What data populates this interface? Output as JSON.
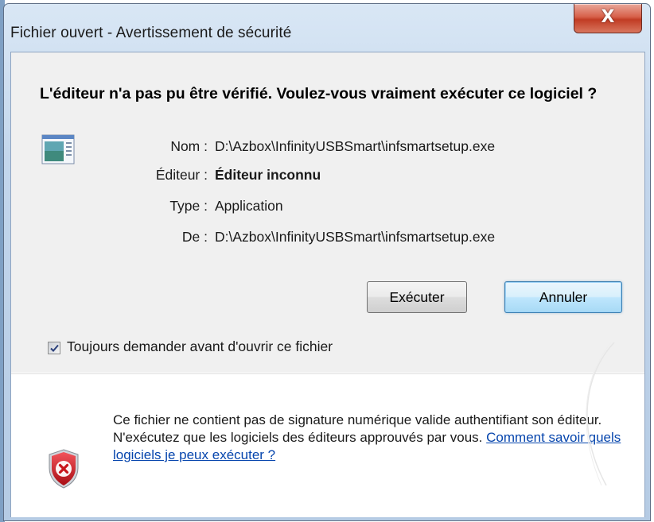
{
  "window": {
    "title": "Fichier ouvert - Avertissement de sécurité",
    "close_glyph": "X"
  },
  "heading": "L'éditeur n'a pas pu être vérifié. Voulez-vous vraiment exécuter ce logiciel ?",
  "details": [
    {
      "label": "Nom :",
      "value": "D:\\Azbox\\InfinityUSBSmart\\infsmartsetup.exe"
    },
    {
      "label": "Éditeur :",
      "value": "Éditeur inconnu"
    },
    {
      "label": "Type :",
      "value": "Application"
    },
    {
      "label": "De :",
      "value": "D:\\Azbox\\InfinityUSBSmart\\infsmartsetup.exe"
    }
  ],
  "buttons": {
    "run": "Exécuter",
    "cancel": "Annuler"
  },
  "checkbox": {
    "label": "Toujours demander avant d'ouvrir ce fichier",
    "checked": true
  },
  "warning": {
    "text": "Ce fichier ne contient pas de signature numérique valide authentifiant son éditeur. N'exécutez que les logiciels des éditeurs approuvés par vous.",
    "link": "Comment savoir quels logiciels je peux exécuter ?"
  },
  "icons": {
    "app": "application-icon",
    "shield": "security-shield-error-icon",
    "check": "checkmark-icon"
  },
  "colors": {
    "link": "#0645ad",
    "shield_red": "#c8151b",
    "title_close": "#c13c24"
  }
}
